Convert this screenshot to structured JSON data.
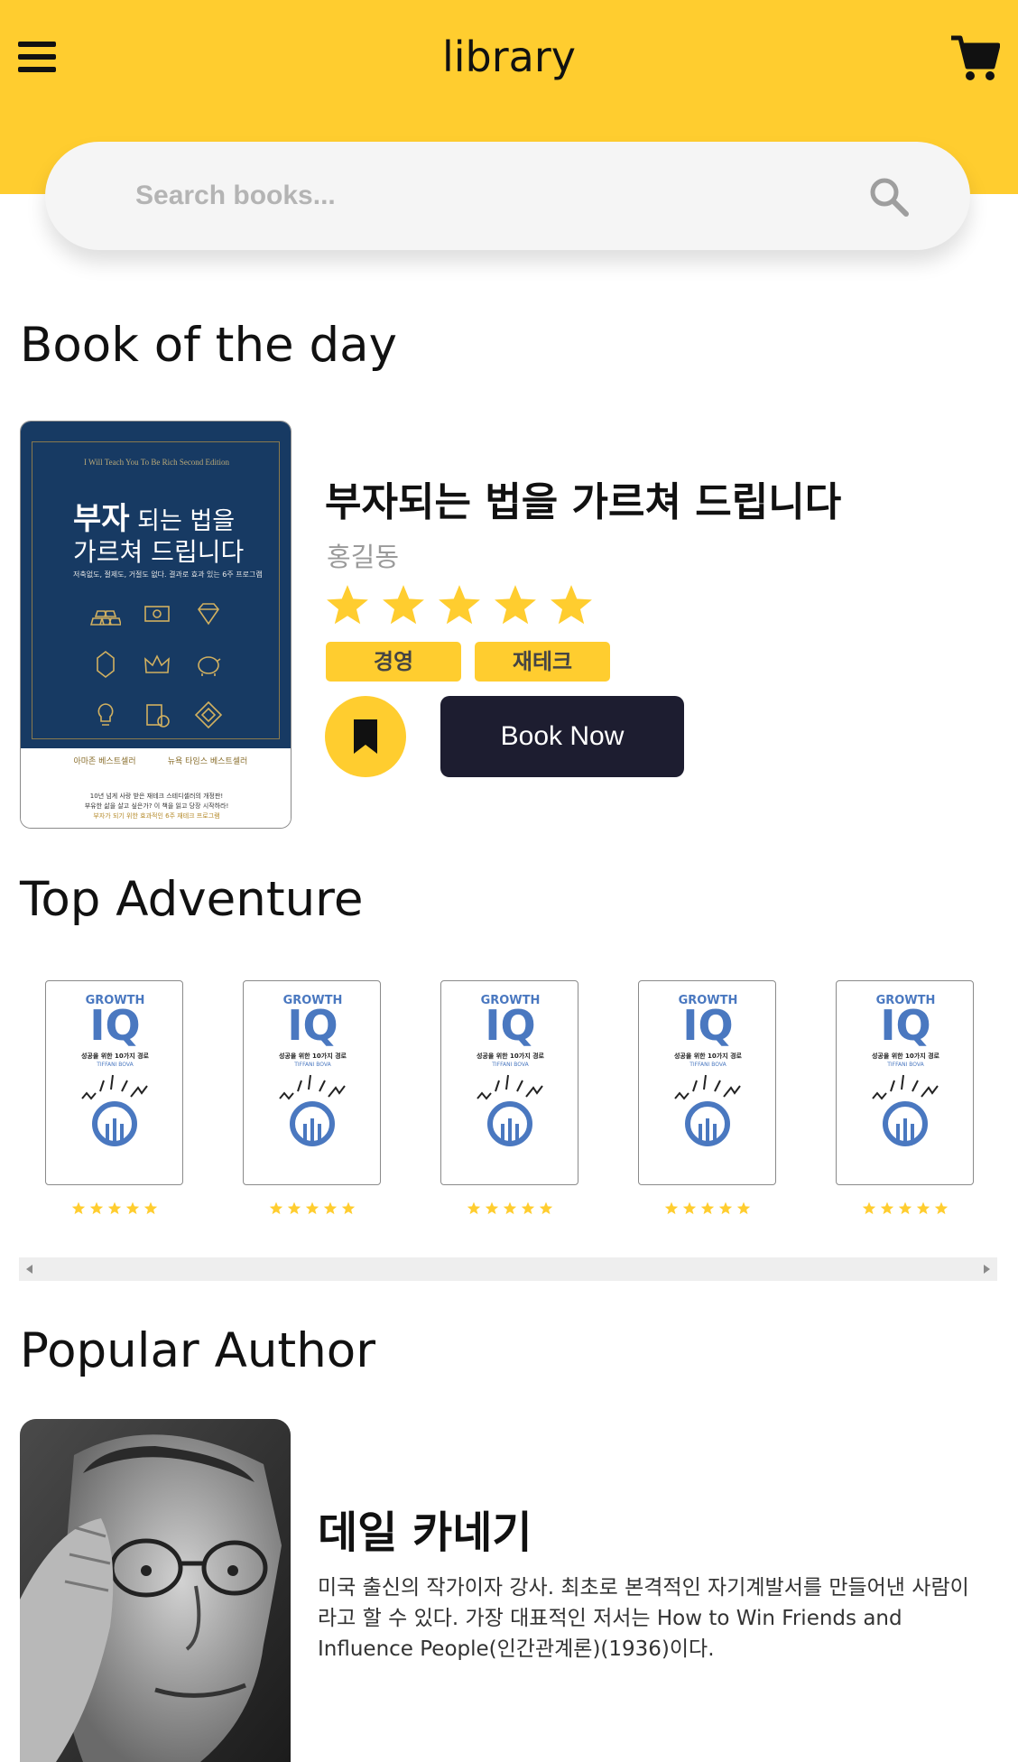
{
  "header": {
    "title": "library",
    "menu_icon": "hamburger-menu-icon",
    "cart_icon": "shopping-cart-icon",
    "background": "#FFCD2F"
  },
  "search": {
    "placeholder": "Search books...",
    "value": "",
    "icon": "search-icon"
  },
  "book_of_the_day": {
    "section_title": "Book of the day",
    "cover": {
      "top_text": "I Will Teach You To Be Rich Second Edition",
      "title_line1_bold": "부자",
      "title_line1_rest": " 되는 법을",
      "title_line2": "가르쳐 드립니다",
      "subtitle": "저축없도, 절제도, 거절도 없다. 결과로 효과 있는 6주 프로그램",
      "laurel_left": "아마존 베스트셀러",
      "laurel_right": "뉴욕 타임스 베스트셀러",
      "bottom_line1": "10년 넘게 사랑 받은 재테크 스테디셀러의 개정판!",
      "bottom_line2": "부유한 삶을 살고 싶은가? 이 책을 읽고 당장 시작하라!",
      "bottom_line3": "부자가 되기 위한 효과적인 6주 재테크 프로그램"
    },
    "title": "부자되는 법을 가르쳐 드립니다",
    "author": "홍길동",
    "rating": 5,
    "rating_max": 5,
    "tags": [
      "경영",
      "재테크"
    ],
    "bookmark_icon": "bookmark-icon",
    "book_now_label": "Book Now"
  },
  "top_adventure": {
    "section_title": "Top Adventure",
    "books": [
      {
        "growth": "GROWTH",
        "iq": "IQ",
        "subtitle": "성공을 위한 10가지 경로",
        "author": "TIFFANI BOVA",
        "rating": 5
      },
      {
        "growth": "GROWTH",
        "iq": "IQ",
        "subtitle": "성공을 위한 10가지 경로",
        "author": "TIFFANI BOVA",
        "rating": 5
      },
      {
        "growth": "GROWTH",
        "iq": "IQ",
        "subtitle": "성공을 위한 10가지 경로",
        "author": "TIFFANI BOVA",
        "rating": 5
      },
      {
        "growth": "GROWTH",
        "iq": "IQ",
        "subtitle": "성공을 위한 10가지 경로",
        "author": "TIFFANI BOVA",
        "rating": 5
      },
      {
        "growth": "GROWTH",
        "iq": "IQ",
        "subtitle": "성공을 위한 10가지 경로",
        "author": "TIFFANI BOVA",
        "rating": 5
      }
    ]
  },
  "popular_author": {
    "section_title": "Popular Author",
    "name": "데일 카네기",
    "bio": "미국 출신의 작가이자 강사. 최초로 본격적인 자기계발서를 만들어낸 사람이라고 할 수 있다. 가장 대표적인 저서는 How to Win Friends and Influence People(인간관계론)(1936)이다."
  },
  "colors": {
    "accent": "#FFCD2F",
    "dark_button": "#1D1D30",
    "star": "#FFCD2F"
  }
}
